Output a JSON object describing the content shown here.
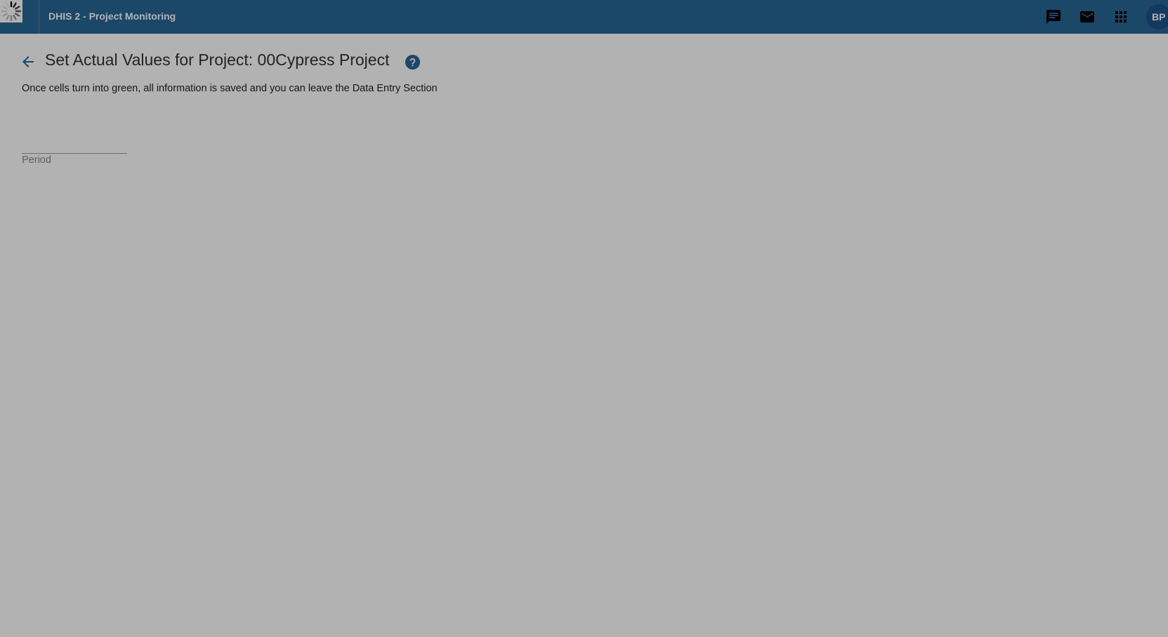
{
  "header": {
    "app_title": "DHIS 2 - Project Monitoring",
    "icons": [
      "message-icon",
      "mail-icon",
      "apps-grid-icon"
    ],
    "avatar_initials": "BP",
    "colors": {
      "bar": "#276696",
      "avatar": "#1d5288"
    }
  },
  "page": {
    "back_icon": "arrow-left-icon",
    "title": "Set Actual Values for Project: 00Cypress Project",
    "help_icon": "help-circle-icon",
    "instructions": "Once cells turn into green, all information is saved and you can leave the Data Entry Section",
    "period_label": "Period"
  },
  "overlay": {
    "loading_icon": "spinner-icon"
  }
}
